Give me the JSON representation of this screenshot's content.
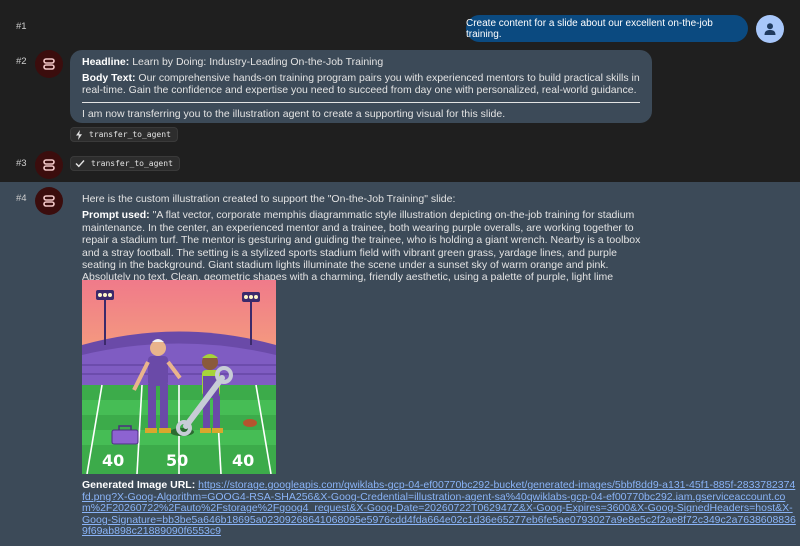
{
  "turns": {
    "t1": "#1",
    "t2": "#2",
    "t3": "#3",
    "t4": "#4"
  },
  "user_message": "Create content for a slide about our excellent on-the-job training.",
  "agent_message_1": {
    "headline_label": "Headline:",
    "headline": "Learn by Doing: Industry-Leading On-the-Job Training",
    "body_label": "Body Text:",
    "body": "Our comprehensive hands-on training program pairs you with experienced mentors to build practical skills in real-time. Gain the confidence and expertise you need to succeed from day one with personalized, real-world guidance.",
    "transfer_note": "I am now transferring you to the illustration agent to create a supporting visual for this slide."
  },
  "tool_chips": {
    "call": "transfer_to_agent",
    "result": "transfer_to_agent"
  },
  "agent_message_2": {
    "intro": "Here is the custom illustration created to support the \"On-the-Job Training\" slide:",
    "prompt_label": "Prompt used:",
    "prompt": "\"A flat vector, corporate memphis diagrammatic style illustration depicting on-the-job training for stadium maintenance. In the center, an experienced mentor and a trainee, both wearing purple overalls, are working together to repair a stadium turf. The mentor is gesturing and guiding the trainee, who is holding a giant wrench. Nearby is a toolbox and a stray football. The setting is a stylized sports stadium field with vibrant green grass, yardage lines, and purple seating in the background. Giant stadium lights illuminate the scene under a sunset sky of warm orange and pink. Absolutely no text. Clean, geometric shapes with a charming, friendly aesthetic, using a palette of purple, light lime green, and sunset colors.\"",
    "image_alt": "On-the-job training illustration",
    "yard_numbers": [
      "40",
      "50",
      "40"
    ],
    "url_label": "Generated Image URL:",
    "url": "https://storage.googleapis.com/qwiklabs-gcp-04-ef00770bc292-bucket/generated-images/5bbf8dd9-a131-45f1-885f-2833782374fd.png?X-Goog-Algorithm=GOOG4-RSA-SHA256&X-Goog-Credential=illustration-agent-sa%40qwiklabs-gcp-04-ef00770bc292.iam.gserviceaccount.com%2F20260722%2Fauto%2Fstorage%2Fgoog4_request&X-Goog-Date=20260722T062947Z&X-Goog-Expires=3600&X-Goog-SignedHeaders=host&X-Goog-Signature=bb3be5a646b18695a02309268641068095e5976cdd4fda664e02c1d36e65277eb6fe5ae0793027a9e8e5c2f2ae8f72c349c2a76386088369f69ab898c21889090f6553c9"
  },
  "colors": {
    "page_bg": "#1f1f1f",
    "bubble_bg": "#3c4a58",
    "user_bubble": "#0b4a80",
    "avatar_agent": "#3b0d0d",
    "avatar_user": "#a8c7fa",
    "link": "#8ab4f8"
  },
  "icons": [
    "robot-icon",
    "person-icon",
    "bolt-icon",
    "check-icon"
  ]
}
